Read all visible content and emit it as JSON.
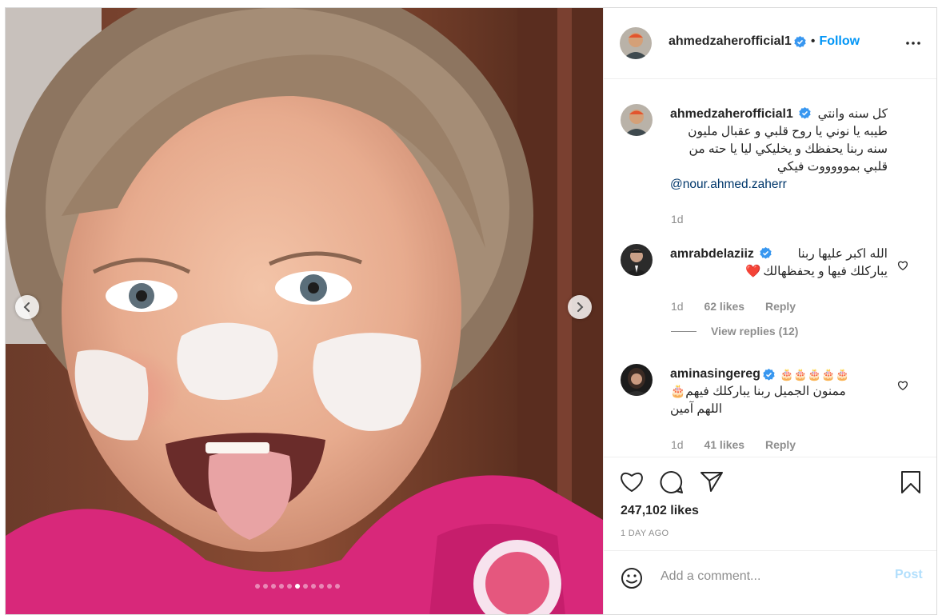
{
  "post": {
    "author": "ahmedzaherofficial1",
    "separator": "•",
    "follow_label": "Follow",
    "more_icon": "more-options-icon"
  },
  "media": {
    "slide_count": 11,
    "active_slide": 5
  },
  "caption": {
    "username": "ahmedzaherofficial1",
    "lines": [
      "كل سنه وانتي",
      "طيبه يا نوني يا روح قلبي و عقبال مليون",
      "سنه ربنا يحفظك و يخليكي ليا يا حته من",
      "قلبي بموووووت فيكي"
    ],
    "mention": "@nour.ahmed.zaherr",
    "time": "1d"
  },
  "comments": [
    {
      "username": "amrabdelaziiz",
      "lines": [
        "الله اكبر عليها ربنا",
        "يباركلك فيها و يحفظهالك"
      ],
      "emoji": "❤️",
      "time": "1d",
      "likes": "62 likes",
      "reply": "Reply"
    },
    {
      "username": "aminasingereg",
      "emoji_line": "🎂🎂🎂🎂🎂",
      "lines": [
        "ممنون الجميل ربنا يباركلك فيهم🎂",
        "اللهم آمين"
      ],
      "time": "1d",
      "likes": "41 likes",
      "reply": "Reply"
    }
  ],
  "view_replies": "View replies (12)",
  "actions": {
    "likes": "247,102 likes",
    "posted": "1 DAY AGO"
  },
  "add_comment": {
    "placeholder": "Add a comment...",
    "post_label": "Post"
  },
  "colors": {
    "link_blue": "#0095f6",
    "post_disabled": "#b2dffc",
    "verified_blue": "#3897f0",
    "heart_red": "#ed4956"
  }
}
